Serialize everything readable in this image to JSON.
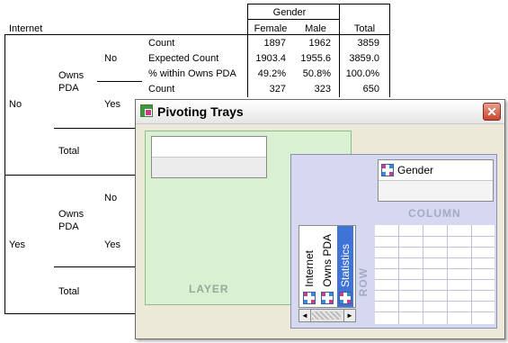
{
  "table": {
    "row_header_label": "Internet",
    "col_group_label": "Gender",
    "col_female": "Female",
    "col_male": "Male",
    "col_total": "Total",
    "outer_no": "No",
    "outer_yes": "Yes",
    "owns_pda_1": "Owns",
    "owns_pda_2": "PDA",
    "inner_no": "No",
    "inner_yes": "Yes",
    "inner_total": "Total",
    "rows": [
      {
        "stat": "Count",
        "female": "1897",
        "male": "1962",
        "total": "3859"
      },
      {
        "stat": "Expected Count",
        "female": "1903.4",
        "male": "1955.6",
        "total": "3859.0"
      },
      {
        "stat": "% within Owns PDA",
        "female": "49.2%",
        "male": "50.8%",
        "total": "100.0%"
      },
      {
        "stat": "Count",
        "female": "327",
        "male": "323",
        "total": "650"
      }
    ]
  },
  "dialog": {
    "title": "Pivoting Trays",
    "close_glyph": "✕",
    "layer_label": "LAYER",
    "column_label": "COLUMN",
    "row_label": "ROW",
    "column_items": [
      "Gender"
    ],
    "row_items": [
      "Internet",
      "Owns PDA",
      "Statistics"
    ],
    "scroll_left": "◄",
    "scroll_right": "►",
    "icons": [
      "pivot-trays-icon",
      "field-icon"
    ],
    "colors": {
      "layer_bg": "#d9f1d2",
      "pivot_bg": "#d6d8ef",
      "close_btn": "#c8452e"
    }
  }
}
